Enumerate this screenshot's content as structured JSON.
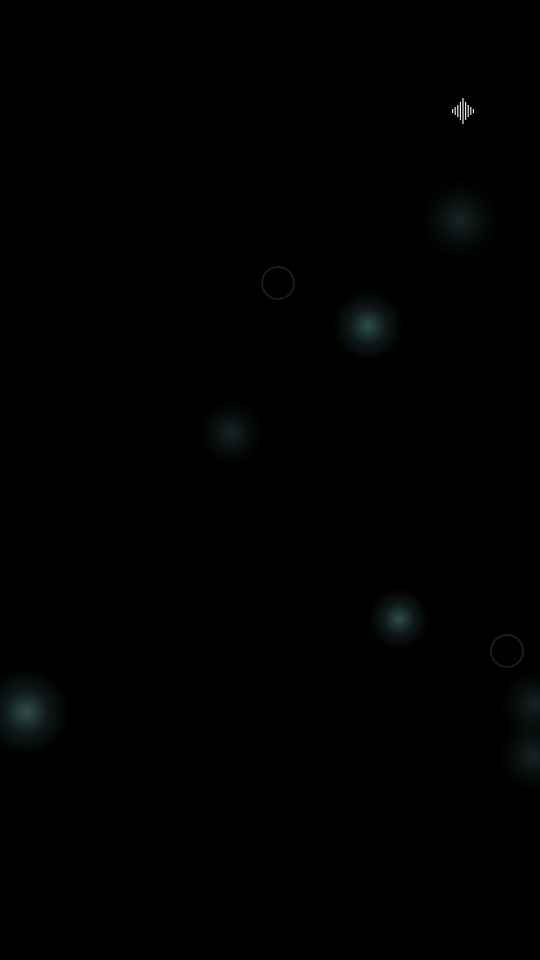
{
  "screen": {
    "background_color": "#000000",
    "bokeh_color": "#5a8c8c"
  },
  "controls": {
    "voice_icon": "waveform-icon",
    "icon_color": "#e6e6e6"
  }
}
